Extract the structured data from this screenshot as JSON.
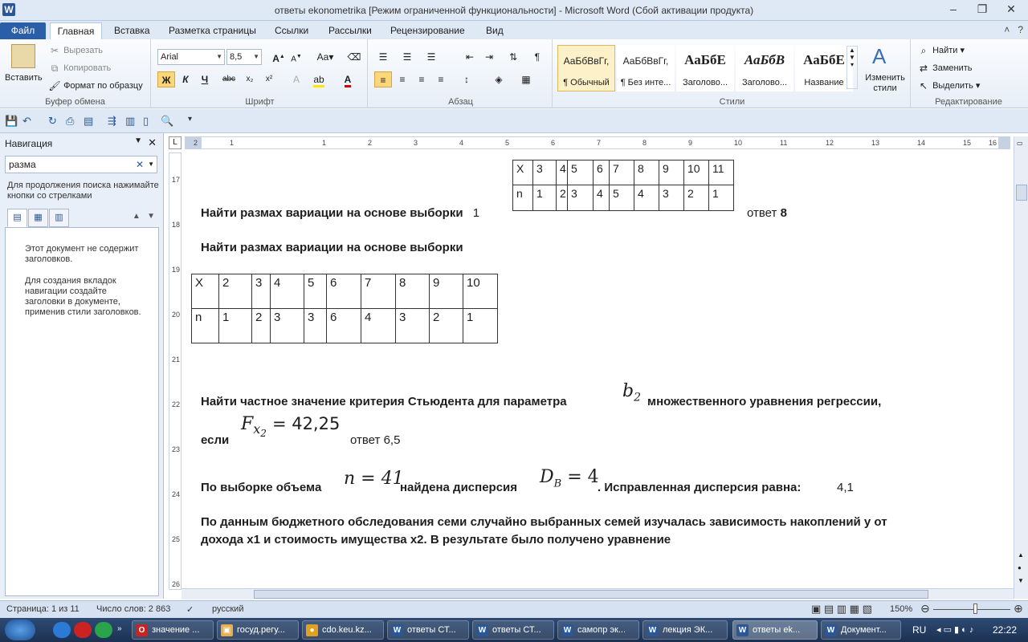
{
  "window": {
    "title": "ответы ekonometrika [Режим ограниченной функциональности]  -  Microsoft Word (Сбой активации продукта)"
  },
  "tabs": [
    "Файл",
    "Главная",
    "Вставка",
    "Разметка страницы",
    "Ссылки",
    "Рассылки",
    "Рецензирование",
    "Вид"
  ],
  "ribbon": {
    "clipboard": {
      "paste": "Вставить",
      "cut": "Вырезать",
      "copy": "Копировать",
      "format_painter": "Формат по образцу",
      "label": "Буфер обмена"
    },
    "font": {
      "name": "Arial",
      "size": "8,5",
      "label": "Шрифт",
      "bold": "Ж",
      "italic": "К",
      "underline": "Ч",
      "strike": "abc",
      "case": "Aa"
    },
    "paragraph": {
      "label": "Абзац",
      "pilcrow": "¶"
    },
    "styles": {
      "label": "Стили",
      "items": [
        {
          "sample": "АаБбВвГг,",
          "name": "¶ Обычный"
        },
        {
          "sample": "АаБбВвГг,",
          "name": "¶ Без инте..."
        },
        {
          "sample": "АаБбЕ",
          "name": "Заголово..."
        },
        {
          "sample": "АаБбВ",
          "name": "Заголово..."
        },
        {
          "sample": "АаБбЕ",
          "name": "Название"
        }
      ],
      "change_styles": "Изменить стили"
    },
    "editing": {
      "label": "Редактирование",
      "find": "Найти",
      "replace": "Заменить",
      "select": "Выделить"
    }
  },
  "nav": {
    "title": "Навигация",
    "search_value": "разма",
    "hint": "Для продолжения поиска нажимайте кнопки со стрелками",
    "msg1": "Этот документ не содержит заголовков.",
    "msg2": "Для создания вкладок навигации создайте заголовки в документе, применив стили заголовков."
  },
  "ruler": {
    "h": [
      "2",
      "1",
      "1",
      "2",
      "3",
      "4",
      "5",
      "6",
      "7",
      "8",
      "9",
      "10",
      "11",
      "12",
      "13",
      "14",
      "15",
      "16",
      "17"
    ],
    "v": [
      "17",
      "18",
      "19",
      "20",
      "21",
      "22",
      "23",
      "24",
      "25",
      "26"
    ]
  },
  "doc": {
    "table1": {
      "row1": [
        "X",
        "3",
        "4",
        "5",
        "6",
        "7",
        "8",
        "9",
        "10",
        "11"
      ],
      "row2": [
        "n",
        "1",
        "2",
        "3",
        "4",
        "5",
        "4",
        "3",
        "2",
        "1"
      ]
    },
    "q1": "Найти размах вариации на основе выборки",
    "q1_fragment": "1",
    "q1_answer_label": "ответ",
    "q1_answer": "8",
    "q2": "Найти размах вариации на основе выборки",
    "table2": {
      "row1": [
        "X",
        "2",
        "3",
        "4",
        "5",
        "6",
        "7",
        "8",
        "9",
        "10"
      ],
      "row2": [
        "n",
        "1",
        "2",
        "3",
        "3",
        "6",
        "4",
        "3",
        "2",
        "1"
      ]
    },
    "q3_part1": "Найти частное значение критерия Стьюдента для параметра",
    "q3_b": "b",
    "q3_b_sub": "2",
    "q3_part2": "множественного уравнения регрессии,",
    "q3_if": "если",
    "q3_F": "F",
    "q3_F_sub": "x",
    "q3_F_subsub": "2",
    "q3_eq": "= 42,25",
    "q3_answer": "ответ 6,5",
    "q4_part1": "По выборке объема",
    "q4_n": "n = 41",
    "q4_part2": "найдена дисперсия",
    "q4_D": "D",
    "q4_D_sub": "B",
    "q4_D_eq": "= 4",
    "q4_part3": ". Исправленная дисперсия равна:",
    "q4_answer": "4,1",
    "q5_line1": "По данным бюджетного обследования семи случайно выбранных семей изучалась зависимость накоплений у от",
    "q5_line2": "дохода х1 и стоимость имущества х2. В результате было получено уравнение"
  },
  "status": {
    "page": "Страница: 1 из 11",
    "words": "Число слов: 2 863",
    "lang": "русский",
    "zoom": "150%"
  },
  "taskbar": {
    "items": [
      {
        "label": "значение ...",
        "icon": "O",
        "color": "#cc2222"
      },
      {
        "label": "госуд.регу...",
        "icon": "▣",
        "color": "#e8b04a"
      },
      {
        "label": "cdo.keu.kz...",
        "icon": "●",
        "color": "#e0a020"
      },
      {
        "label": "ответы СТ...",
        "icon": "W",
        "color": "#2b5797"
      },
      {
        "label": "ответы СТ...",
        "icon": "W",
        "color": "#2b5797"
      },
      {
        "label": "самопр эк...",
        "icon": "W",
        "color": "#2b5797"
      },
      {
        "label": "лекция ЭК...",
        "icon": "W",
        "color": "#2b5797"
      },
      {
        "label": "ответы ek...",
        "icon": "W",
        "color": "#2b5797"
      },
      {
        "label": "Документ...",
        "icon": "W",
        "color": "#2b5797"
      }
    ],
    "lang": "RU",
    "time": "22:22"
  }
}
